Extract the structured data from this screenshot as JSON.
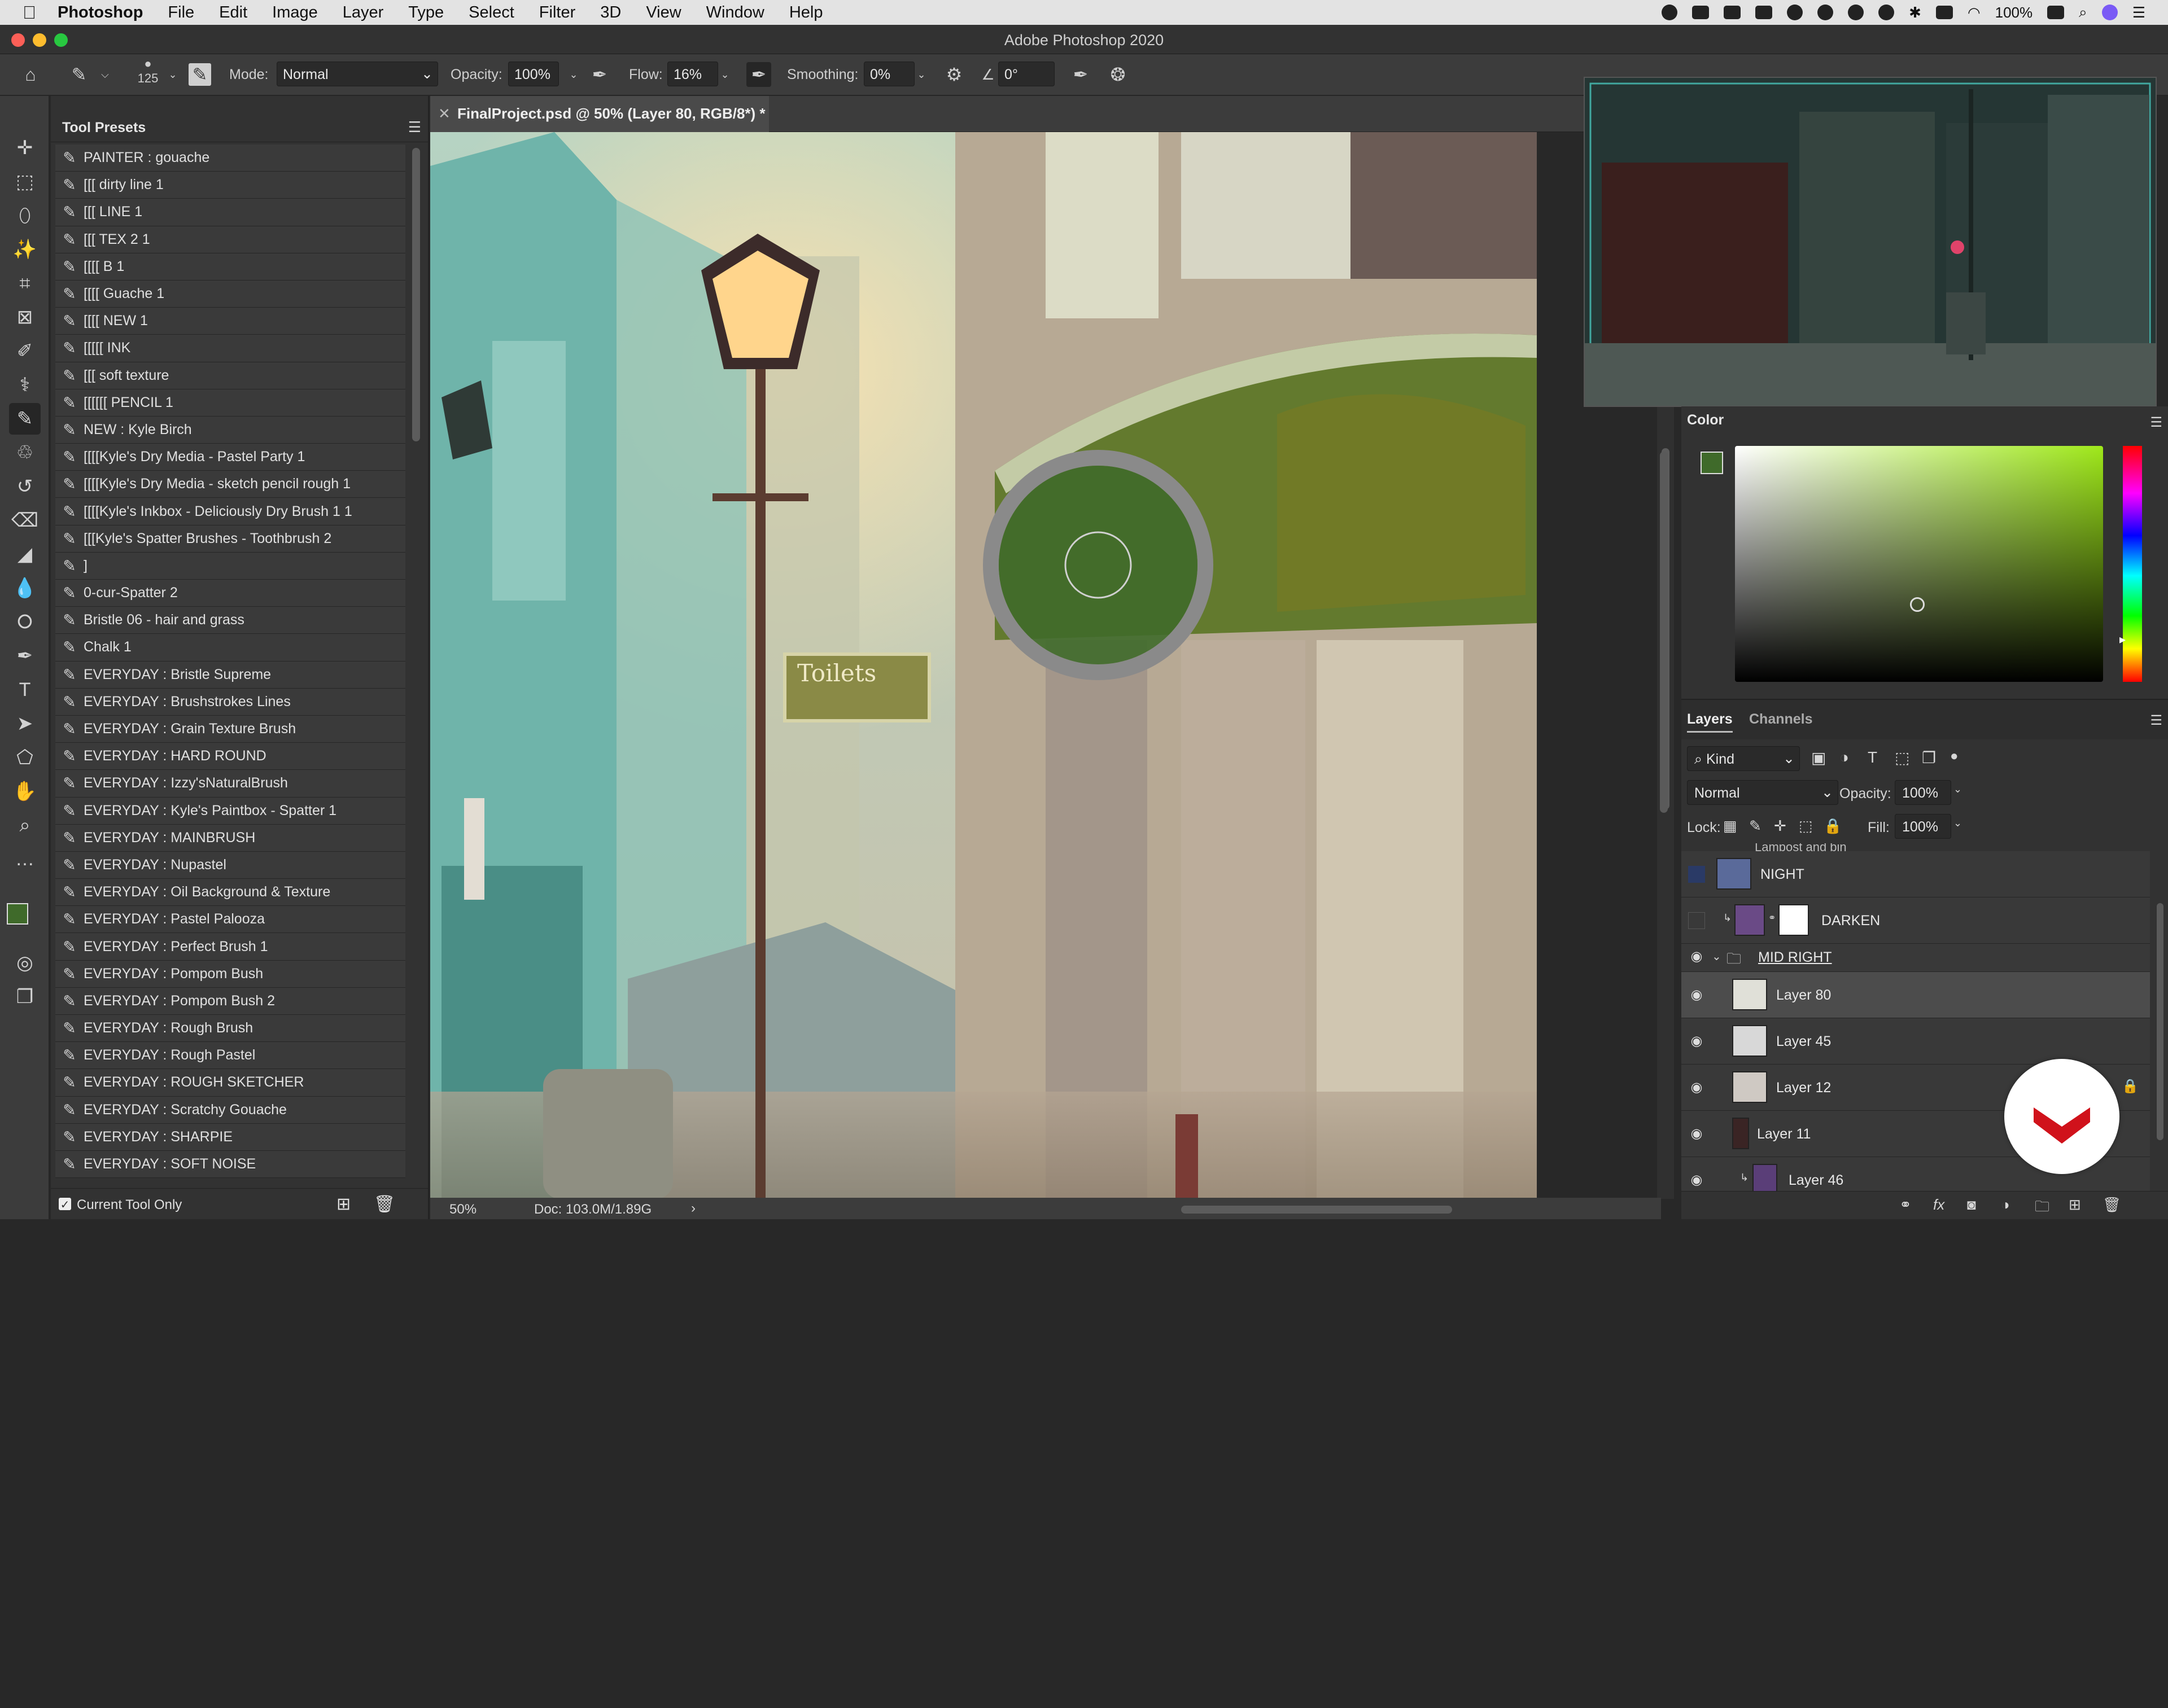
{
  "menubar": {
    "app": "Photoshop",
    "items": [
      "File",
      "Edit",
      "Image",
      "Layer",
      "Type",
      "Select",
      "Filter",
      "3D",
      "View",
      "Window",
      "Help"
    ],
    "battery": "100%"
  },
  "window": {
    "title": "Adobe Photoshop 2020"
  },
  "options_bar": {
    "brush_size": "125",
    "mode_label": "Mode:",
    "mode_value": "Normal",
    "opacity_label": "Opacity:",
    "opacity_value": "100%",
    "flow_label": "Flow:",
    "flow_value": "16%",
    "smoothing_label": "Smoothing:",
    "smoothing_value": "0%",
    "angle_value": "0°"
  },
  "tool_presets": {
    "title": "Tool Presets",
    "items": [
      "PAINTER : gouache",
      "[[[ dirty line 1",
      "[[[ LINE 1",
      "[[[ TEX 2 1",
      "[[[[ B 1",
      "[[[[ Guache 1",
      "[[[[ NEW 1",
      "[[[[[ INK",
      "[[[ soft texture",
      "[[[[[[ PENCIL 1",
      "NEW : Kyle Birch",
      "[[[[Kyle's Dry Media - Pastel Party 1",
      "[[[[Kyle's Dry Media - sketch pencil rough 1",
      "[[[[Kyle's Inkbox - Deliciously Dry Brush 1 1",
      "[[[Kyle's Spatter Brushes - Toothbrush 2",
      "]",
      "0-cur-Spatter 2",
      "Bristle 06 - hair and grass",
      "Chalk 1",
      "EVERYDAY : Bristle Supreme",
      "EVERYDAY : Brushstrokes Lines",
      "EVERYDAY : Grain Texture Brush",
      "EVERYDAY : HARD ROUND",
      "EVERYDAY : Izzy'sNaturalBrush",
      "EVERYDAY : Kyle's Paintbox - Spatter 1",
      "EVERYDAY : MAINBRUSH",
      "EVERYDAY : Nupastel",
      "EVERYDAY : Oil Background & Texture",
      "EVERYDAY : Pastel Palooza",
      "EVERYDAY : Perfect Brush 1",
      "EVERYDAY : Pompom Bush",
      "EVERYDAY : Pompom Bush 2",
      "EVERYDAY : Rough Brush",
      "EVERYDAY : Rough Pastel",
      "EVERYDAY : ROUGH SKETCHER",
      "EVERYDAY : Scratchy Gouache",
      "EVERYDAY : SHARPIE",
      "EVERYDAY : SOFT NOISE"
    ],
    "current_tool_only": "Current Tool Only"
  },
  "document": {
    "tab_title": "FinalProject.psd @ 50% (Layer 80, RGB/8*) *",
    "zoom": "50%",
    "doc_size": "Doc: 103.0M/1.89G",
    "sign_text": "Toilets"
  },
  "color_panel": {
    "title": "Color",
    "foreground": "#3f6a2a",
    "background": "#ffffff"
  },
  "layers_panel": {
    "tabs": [
      "Layers",
      "Channels"
    ],
    "filter_kind": "Kind",
    "blend_mode": "Normal",
    "opacity_label": "Opacity:",
    "opacity_value": "100%",
    "lock_label": "Lock:",
    "fill_label": "Fill:",
    "fill_value": "100%",
    "cut_layer": "Lampost and bin",
    "layers": [
      {
        "name": "NIGHT",
        "visible": false
      },
      {
        "name": "DARKEN",
        "visible": false
      },
      {
        "name": "MID RIGHT",
        "visible": true,
        "group": true
      },
      {
        "name": "Layer 80",
        "visible": true,
        "selected": true
      },
      {
        "name": "Layer 45",
        "visible": true
      },
      {
        "name": "Layer 12",
        "visible": true
      },
      {
        "name": "Layer 11",
        "visible": true
      },
      {
        "name": "Layer 46",
        "visible": true
      }
    ]
  }
}
